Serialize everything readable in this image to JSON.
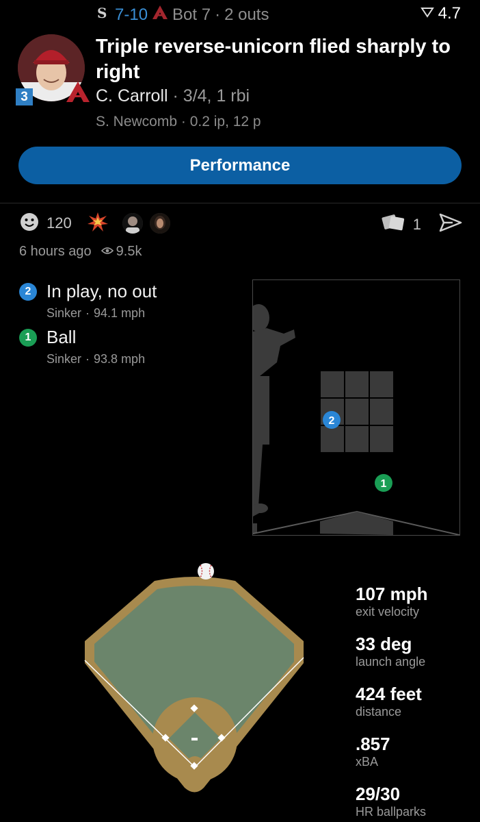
{
  "header": {
    "away_team_icon": "white-sox-logo",
    "score": "7-10",
    "home_team_icon": "diamondbacks-logo",
    "inning": "Bot 7",
    "outs": "2 outs",
    "separator": "·",
    "rating": "4.7",
    "rating_icon": "funnel-down-icon"
  },
  "play": {
    "batting_order": "3",
    "title": "Triple reverse-unicorn flied sharply to right",
    "batter_name": "C. Carroll",
    "batter_stats": "· 3/4, 1 rbi",
    "pitcher_line": "S. Newcomb · 0.2 ip, 12 p"
  },
  "performance_button": "Performance",
  "reactions": {
    "count": "120",
    "share_count": "1"
  },
  "meta": {
    "time_ago": "6 hours ago",
    "views": "9.5k"
  },
  "pitches": [
    {
      "number": "2",
      "result": "In play, no out",
      "type": "Sinker",
      "sep": "·",
      "speed": "94.1 mph",
      "color": "#2a86d6"
    },
    {
      "number": "1",
      "result": "Ball",
      "type": "Sinker",
      "sep": "·",
      "speed": "93.8 mph",
      "color": "#1a9e55"
    }
  ],
  "stats": [
    {
      "value": "107 mph",
      "label": "exit velocity"
    },
    {
      "value": "33 deg",
      "label": "launch angle"
    },
    {
      "value": "424 feet",
      "label": "distance"
    },
    {
      "value": ".857",
      "label": "xBA"
    },
    {
      "value": "29/30",
      "label": "HR ballparks"
    }
  ],
  "colors": {
    "accent_blue": "#2a86d6",
    "button_blue": "#0c5fa3",
    "grass": "#6b856b",
    "dirt": "#a88a4e"
  }
}
